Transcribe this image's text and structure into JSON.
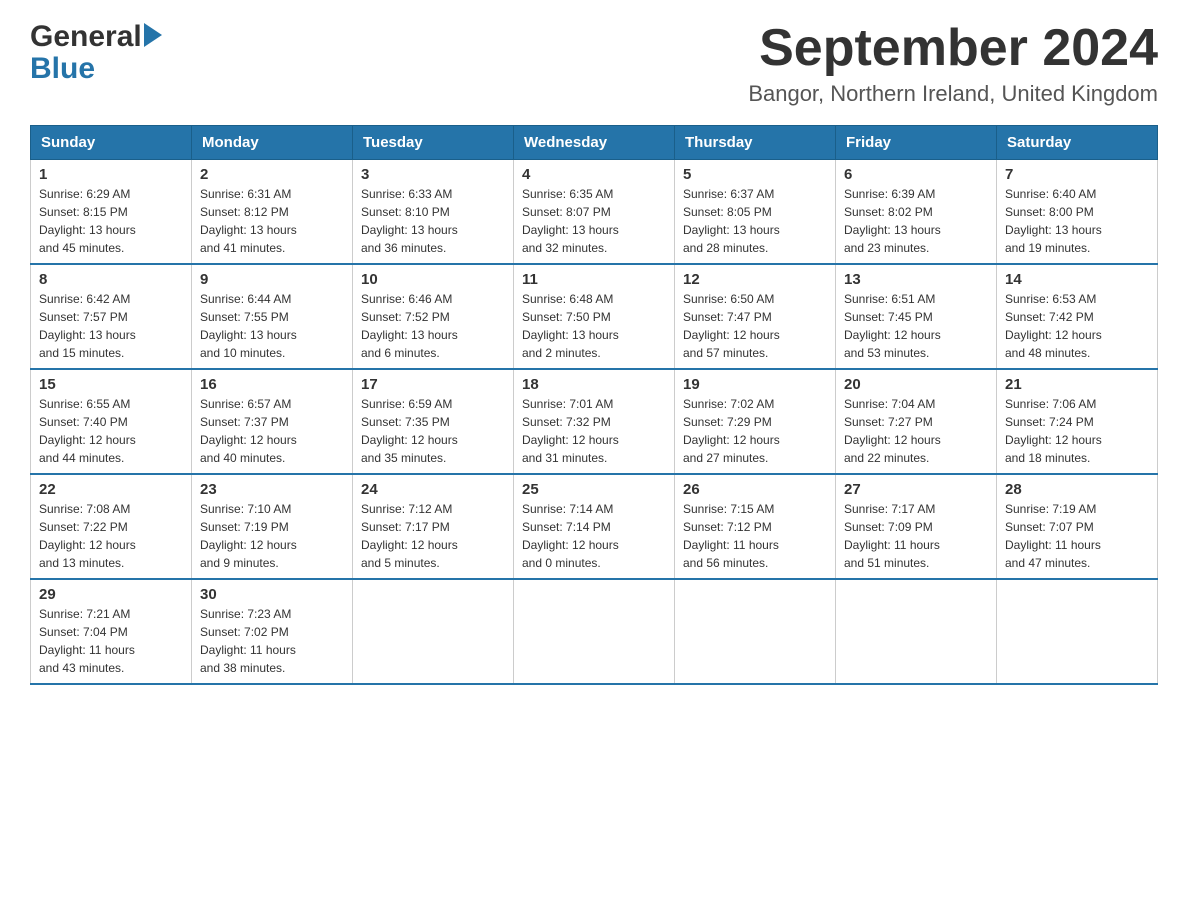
{
  "logo": {
    "general": "General",
    "blue": "Blue"
  },
  "title": "September 2024",
  "subtitle": "Bangor, Northern Ireland, United Kingdom",
  "columns": [
    "Sunday",
    "Monday",
    "Tuesday",
    "Wednesday",
    "Thursday",
    "Friday",
    "Saturday"
  ],
  "weeks": [
    [
      {
        "day": "1",
        "info": "Sunrise: 6:29 AM\nSunset: 8:15 PM\nDaylight: 13 hours\nand 45 minutes."
      },
      {
        "day": "2",
        "info": "Sunrise: 6:31 AM\nSunset: 8:12 PM\nDaylight: 13 hours\nand 41 minutes."
      },
      {
        "day": "3",
        "info": "Sunrise: 6:33 AM\nSunset: 8:10 PM\nDaylight: 13 hours\nand 36 minutes."
      },
      {
        "day": "4",
        "info": "Sunrise: 6:35 AM\nSunset: 8:07 PM\nDaylight: 13 hours\nand 32 minutes."
      },
      {
        "day": "5",
        "info": "Sunrise: 6:37 AM\nSunset: 8:05 PM\nDaylight: 13 hours\nand 28 minutes."
      },
      {
        "day": "6",
        "info": "Sunrise: 6:39 AM\nSunset: 8:02 PM\nDaylight: 13 hours\nand 23 minutes."
      },
      {
        "day": "7",
        "info": "Sunrise: 6:40 AM\nSunset: 8:00 PM\nDaylight: 13 hours\nand 19 minutes."
      }
    ],
    [
      {
        "day": "8",
        "info": "Sunrise: 6:42 AM\nSunset: 7:57 PM\nDaylight: 13 hours\nand 15 minutes."
      },
      {
        "day": "9",
        "info": "Sunrise: 6:44 AM\nSunset: 7:55 PM\nDaylight: 13 hours\nand 10 minutes."
      },
      {
        "day": "10",
        "info": "Sunrise: 6:46 AM\nSunset: 7:52 PM\nDaylight: 13 hours\nand 6 minutes."
      },
      {
        "day": "11",
        "info": "Sunrise: 6:48 AM\nSunset: 7:50 PM\nDaylight: 13 hours\nand 2 minutes."
      },
      {
        "day": "12",
        "info": "Sunrise: 6:50 AM\nSunset: 7:47 PM\nDaylight: 12 hours\nand 57 minutes."
      },
      {
        "day": "13",
        "info": "Sunrise: 6:51 AM\nSunset: 7:45 PM\nDaylight: 12 hours\nand 53 minutes."
      },
      {
        "day": "14",
        "info": "Sunrise: 6:53 AM\nSunset: 7:42 PM\nDaylight: 12 hours\nand 48 minutes."
      }
    ],
    [
      {
        "day": "15",
        "info": "Sunrise: 6:55 AM\nSunset: 7:40 PM\nDaylight: 12 hours\nand 44 minutes."
      },
      {
        "day": "16",
        "info": "Sunrise: 6:57 AM\nSunset: 7:37 PM\nDaylight: 12 hours\nand 40 minutes."
      },
      {
        "day": "17",
        "info": "Sunrise: 6:59 AM\nSunset: 7:35 PM\nDaylight: 12 hours\nand 35 minutes."
      },
      {
        "day": "18",
        "info": "Sunrise: 7:01 AM\nSunset: 7:32 PM\nDaylight: 12 hours\nand 31 minutes."
      },
      {
        "day": "19",
        "info": "Sunrise: 7:02 AM\nSunset: 7:29 PM\nDaylight: 12 hours\nand 27 minutes."
      },
      {
        "day": "20",
        "info": "Sunrise: 7:04 AM\nSunset: 7:27 PM\nDaylight: 12 hours\nand 22 minutes."
      },
      {
        "day": "21",
        "info": "Sunrise: 7:06 AM\nSunset: 7:24 PM\nDaylight: 12 hours\nand 18 minutes."
      }
    ],
    [
      {
        "day": "22",
        "info": "Sunrise: 7:08 AM\nSunset: 7:22 PM\nDaylight: 12 hours\nand 13 minutes."
      },
      {
        "day": "23",
        "info": "Sunrise: 7:10 AM\nSunset: 7:19 PM\nDaylight: 12 hours\nand 9 minutes."
      },
      {
        "day": "24",
        "info": "Sunrise: 7:12 AM\nSunset: 7:17 PM\nDaylight: 12 hours\nand 5 minutes."
      },
      {
        "day": "25",
        "info": "Sunrise: 7:14 AM\nSunset: 7:14 PM\nDaylight: 12 hours\nand 0 minutes."
      },
      {
        "day": "26",
        "info": "Sunrise: 7:15 AM\nSunset: 7:12 PM\nDaylight: 11 hours\nand 56 minutes."
      },
      {
        "day": "27",
        "info": "Sunrise: 7:17 AM\nSunset: 7:09 PM\nDaylight: 11 hours\nand 51 minutes."
      },
      {
        "day": "28",
        "info": "Sunrise: 7:19 AM\nSunset: 7:07 PM\nDaylight: 11 hours\nand 47 minutes."
      }
    ],
    [
      {
        "day": "29",
        "info": "Sunrise: 7:21 AM\nSunset: 7:04 PM\nDaylight: 11 hours\nand 43 minutes."
      },
      {
        "day": "30",
        "info": "Sunrise: 7:23 AM\nSunset: 7:02 PM\nDaylight: 11 hours\nand 38 minutes."
      },
      {
        "day": "",
        "info": ""
      },
      {
        "day": "",
        "info": ""
      },
      {
        "day": "",
        "info": ""
      },
      {
        "day": "",
        "info": ""
      },
      {
        "day": "",
        "info": ""
      }
    ]
  ]
}
